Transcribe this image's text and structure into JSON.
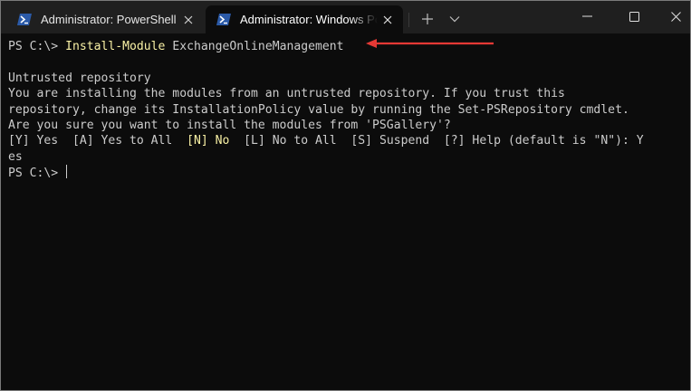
{
  "tabs": [
    {
      "title": "Administrator: PowerShell",
      "active": false,
      "icon": "powershell-icon"
    },
    {
      "title": "Administrator: Windows PowerShell",
      "active": true,
      "icon": "powershell-icon"
    }
  ],
  "titlebar": {
    "new_tab_icon": "plus-icon",
    "dropdown_icon": "chevron-down-icon",
    "minimize_icon": "minimize-icon",
    "maximize_icon": "maximize-icon",
    "close_icon": "close-icon"
  },
  "terminal": {
    "prompt1": "PS C:\\> ",
    "command": "Install-Module",
    "command_arg": " ExchangeOnlineManagement",
    "heading": "Untrusted repository",
    "msg_line1": "You are installing the modules from an untrusted repository. If you trust this",
    "msg_line2": "repository, change its InstallationPolicy value by running the Set-PSRepository cmdlet.",
    "msg_line3": "Are you sure you want to install the modules from 'PSGallery'?",
    "choice_y": "[Y] Yes  ",
    "choice_a": "[A] Yes to All  ",
    "choice_n": "[N] No",
    "choice_rest": "  [L] No to All  [S] Suspend  [?] Help (default is \"N\"): Y",
    "answer_wrap": "es",
    "prompt2": "PS C:\\> "
  },
  "colors": {
    "terminal_bg": "#0c0c0c",
    "terminal_fg": "#cccccc",
    "highlight_yellow": "#f9f1a5",
    "annotation_arrow": "#e53935",
    "titlebar_bg": "#1f1f1f"
  }
}
